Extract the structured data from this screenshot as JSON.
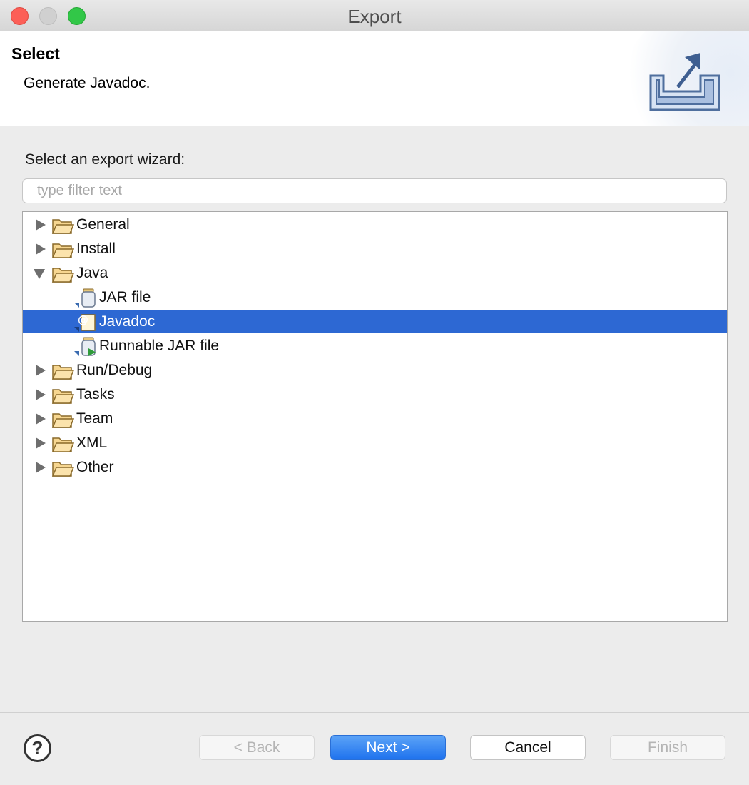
{
  "window": {
    "title": "Export"
  },
  "header": {
    "title": "Select",
    "description": "Generate Javadoc."
  },
  "main": {
    "section_label": "Select an export wizard:",
    "filter": {
      "placeholder": "type filter text",
      "value": ""
    }
  },
  "tree": {
    "items": [
      {
        "label": "General",
        "type": "folder",
        "expanded": false
      },
      {
        "label": "Install",
        "type": "folder",
        "expanded": false
      },
      {
        "label": "Java",
        "type": "folder",
        "expanded": true
      },
      {
        "label": "JAR file",
        "type": "jar",
        "selected": false
      },
      {
        "label": "Javadoc",
        "type": "javadoc",
        "selected": true
      },
      {
        "label": "Runnable JAR file",
        "type": "runnable-jar",
        "selected": false
      },
      {
        "label": "Run/Debug",
        "type": "folder",
        "expanded": false
      },
      {
        "label": "Tasks",
        "type": "folder",
        "expanded": false
      },
      {
        "label": "Team",
        "type": "folder",
        "expanded": false
      },
      {
        "label": "XML",
        "type": "folder",
        "expanded": false
      },
      {
        "label": "Other",
        "type": "folder",
        "expanded": false
      }
    ]
  },
  "footer": {
    "help_symbol": "?",
    "back_label": "< Back",
    "next_label": "Next >",
    "cancel_label": "Cancel",
    "finish_label": "Finish"
  },
  "colors": {
    "selection": "#2d68d3",
    "primary_button": "#1f73ee",
    "folder": "#f3c06b"
  }
}
